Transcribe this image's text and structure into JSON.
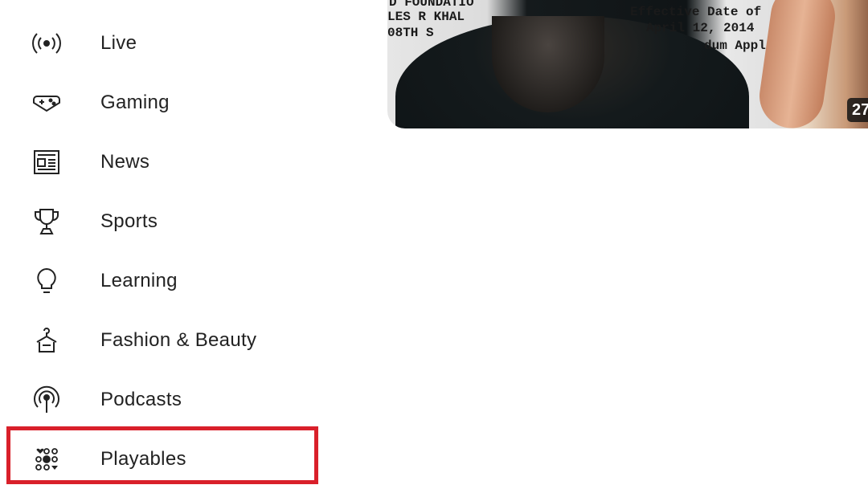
{
  "sidebar": {
    "items": [
      {
        "label": "Live",
        "icon": "live-broadcast-icon"
      },
      {
        "label": "Gaming",
        "icon": "gamepad-icon"
      },
      {
        "label": "News",
        "icon": "newspaper-icon"
      },
      {
        "label": "Sports",
        "icon": "trophy-icon"
      },
      {
        "label": "Learning",
        "icon": "lightbulb-icon"
      },
      {
        "label": "Fashion & Beauty",
        "icon": "hanger-icon"
      },
      {
        "label": "Podcasts",
        "icon": "podcast-icon"
      },
      {
        "label": "Playables",
        "icon": "playables-icon"
      }
    ],
    "highlighted_item": "Playables",
    "highlight_color": "#d9202a"
  },
  "video": {
    "thumbnail_text": [
      "D FOUNDATIO",
      "LES R KHAL",
      "08TH S",
      "Effective Date of",
      "April 12, 2014",
      "dum Applies:"
    ],
    "duration": "27"
  }
}
